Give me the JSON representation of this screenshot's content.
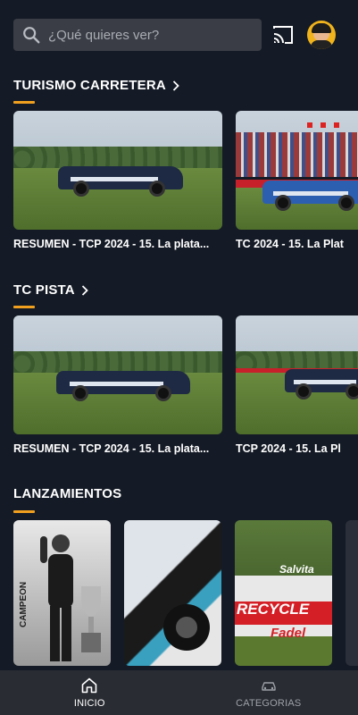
{
  "search": {
    "placeholder": "¿Qué quieres ver?"
  },
  "header": {
    "cast_icon": "cast-icon",
    "avatar_icon": "user-avatar"
  },
  "sections": [
    {
      "title": "TURISMO CARRETERA",
      "cards": [
        {
          "caption": "RESUMEN - TCP 2024 - 15. La plata..."
        },
        {
          "caption": "TC 2024 - 15. La Plat"
        }
      ]
    },
    {
      "title": "TC PISTA",
      "cards": [
        {
          "caption": "RESUMEN - TCP 2024 - 15. La plata..."
        },
        {
          "caption": "TCP 2024 - 15. La Pl"
        }
      ]
    },
    {
      "title": "LANZAMIENTOS",
      "cards": []
    }
  ],
  "launch_texts": {
    "card1_label": "CAMPEON",
    "card3_top": "Salvita",
    "card3_mid": "RECYCLE",
    "card3_bottom": "Fadel"
  },
  "bottom_nav": [
    {
      "label": "INICIO",
      "icon": "home-icon",
      "active": true
    },
    {
      "label": "CATEGORIAS",
      "icon": "car-icon",
      "active": false
    }
  ],
  "colors": {
    "background": "#151b26",
    "accent": "#f0a01e",
    "search_bg": "#3a3d45",
    "nav_bg": "#292c32"
  }
}
